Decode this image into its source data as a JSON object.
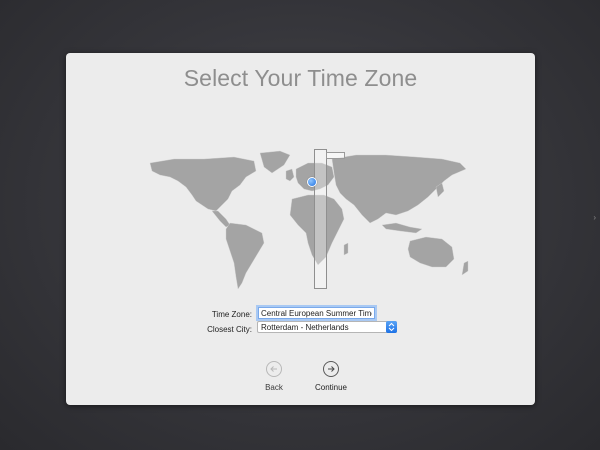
{
  "window": {
    "title": "Select Your Time Zone"
  },
  "form": {
    "time_zone_label": "Time Zone:",
    "time_zone_value": "Central European Summer Time",
    "closest_city_label": "Closest City:",
    "closest_city_value": "Rotterdam - Netherlands"
  },
  "navigation": {
    "back_label": "Back",
    "continue_label": "Continue"
  },
  "icons": {
    "back": "arrow-left-circle-icon",
    "continue": "arrow-right-circle-icon",
    "dropdown": "chevron-updown-icon",
    "location": "location-pin-icon"
  },
  "colors": {
    "background": "#2f2f33",
    "panel": "#ececec",
    "title": "#8e8e8e",
    "map_land": "#a4a4a4",
    "accent": "#1d72e6"
  }
}
